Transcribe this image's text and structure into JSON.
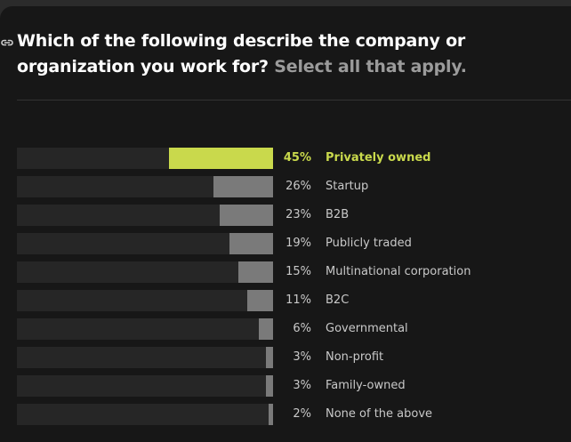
{
  "question": {
    "title": "Which of the following describe the company or organization you work for?",
    "subtitle": "Select all that apply."
  },
  "colors": {
    "highlight": "#c9d94c",
    "bar": "#7a7a7a",
    "track": "#262626",
    "background": "#171717"
  },
  "icons": {
    "question_link": "link-icon"
  },
  "chart_data": {
    "type": "bar",
    "orientation": "horizontal",
    "value_format": "percent",
    "xlim": [
      0,
      100
    ],
    "highlight_index": 0,
    "categories": [
      "Privately owned",
      "Startup",
      "B2B",
      "Publicly traded",
      "Multinational corporation",
      "B2C",
      "Governmental",
      "Non-profit",
      "Family-owned",
      "None of the above"
    ],
    "values": [
      45,
      26,
      23,
      19,
      15,
      11,
      6,
      3,
      3,
      2
    ],
    "labels": [
      "45%",
      "26%",
      "23%",
      "19%",
      "15%",
      "11%",
      "6%",
      "3%",
      "3%",
      "2%"
    ]
  }
}
